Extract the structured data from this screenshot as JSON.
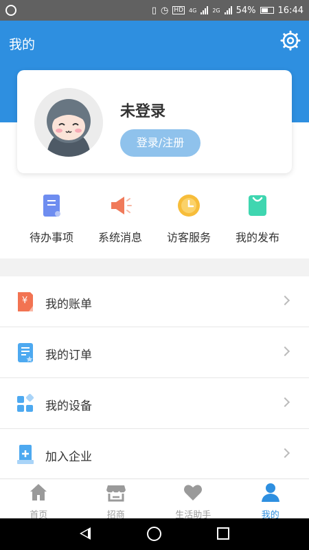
{
  "status_bar": {
    "battery": "54%",
    "time": "16:44",
    "network": "4G",
    "network2": "2G"
  },
  "header": {
    "title": "我的",
    "settings_icon": "gear-icon"
  },
  "profile": {
    "login_status": "未登录",
    "login_button": "登录/注册"
  },
  "quick_actions": [
    {
      "label": "待办事项",
      "icon": "document-icon",
      "color": "#6e8df0"
    },
    {
      "label": "系统消息",
      "icon": "megaphone-icon",
      "color": "#f07a5a"
    },
    {
      "label": "访客服务",
      "icon": "clock-icon",
      "color": "#f7bd3a"
    },
    {
      "label": "我的发布",
      "icon": "shopping-bag-icon",
      "color": "#3fd6b0"
    }
  ],
  "menu": [
    {
      "label": "我的账单",
      "icon": "bill-icon",
      "color": "#f27352"
    },
    {
      "label": "我的订单",
      "icon": "order-icon",
      "color": "#4da9f0"
    },
    {
      "label": "我的设备",
      "icon": "device-grid-icon",
      "color": "#4da9f0"
    },
    {
      "label": "加入企业",
      "icon": "building-icon",
      "color": "#4da9f0"
    }
  ],
  "tabs": [
    {
      "label": "首页",
      "icon": "home-icon",
      "active": false
    },
    {
      "label": "招商",
      "icon": "store-icon",
      "active": false
    },
    {
      "label": "生活助手",
      "icon": "heart-icon",
      "active": false
    },
    {
      "label": "我的",
      "icon": "user-icon",
      "active": true
    }
  ],
  "colors": {
    "primary": "#2e8fe0",
    "button": "#8fc2ec",
    "inactive_tab": "#9a9a9a"
  }
}
